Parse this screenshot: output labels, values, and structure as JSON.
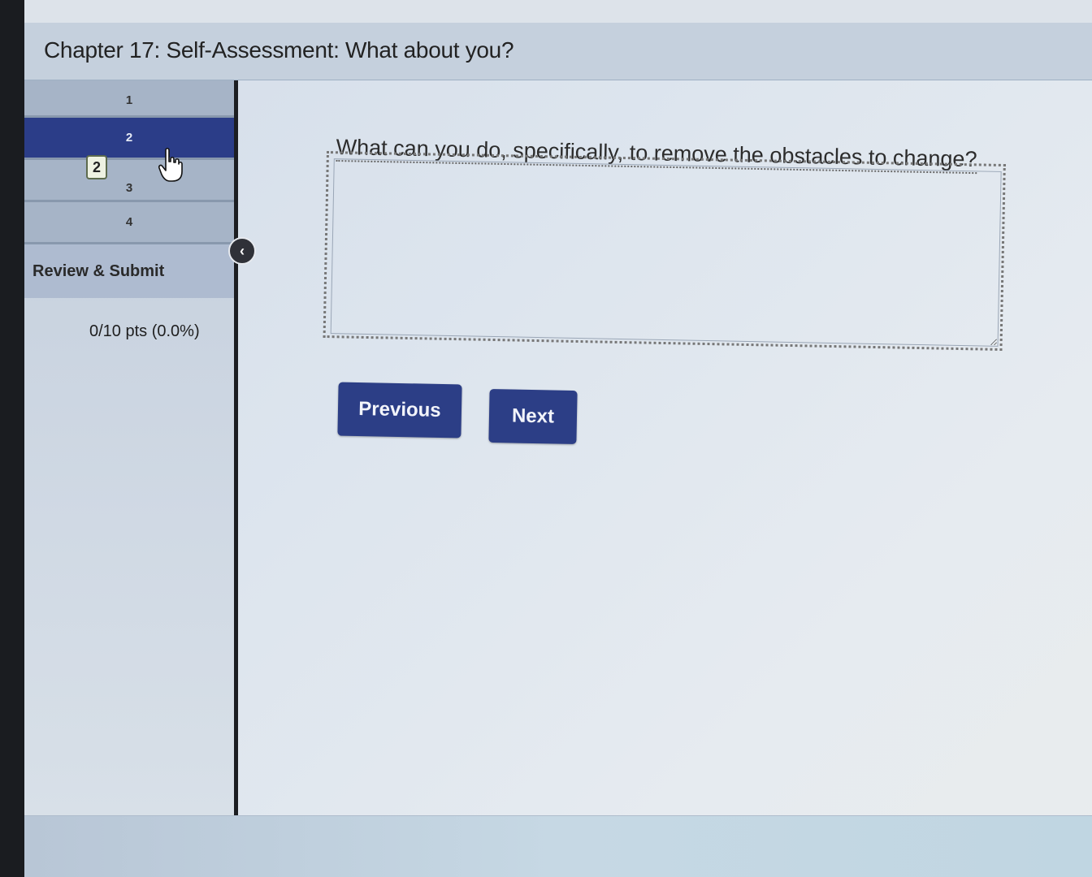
{
  "header": {
    "title": "Chapter 17: Self-Assessment: What about you?"
  },
  "sidebar": {
    "questions": [
      {
        "label": "1"
      },
      {
        "label": "2"
      },
      {
        "label": "3"
      },
      {
        "label": "4"
      }
    ],
    "active_question": "2",
    "current_badge": "2",
    "review_label": "Review & Submit",
    "score": "0/10 pts (0.0%)",
    "collapse_icon": "chevron-left-icon"
  },
  "main": {
    "question_text": "What can you do, specifically, to remove the obstacles to change?",
    "answer_value": "",
    "previous_label": "Previous",
    "next_label": "Next"
  },
  "colors": {
    "active_item": "#2b3d88",
    "button": "#2c3e86",
    "sidebar_item": "#a6b4c7"
  }
}
